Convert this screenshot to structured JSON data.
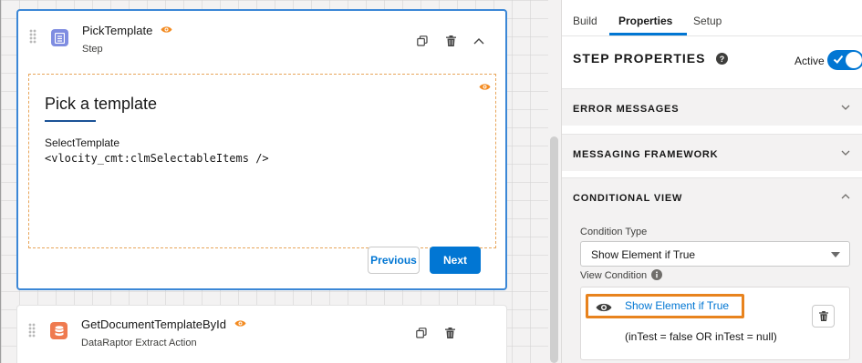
{
  "canvas": {
    "step_card": {
      "title": "PickTemplate",
      "subtitle": "Step",
      "icon": "list-doc-icon",
      "heading": "Pick a template",
      "field_label": "SelectTemplate",
      "code": "<vlocity_cmt:clmSelectableItems />",
      "prev_label": "Previous",
      "next_label": "Next",
      "actions": [
        "clone-icon",
        "delete-icon",
        "collapse-icon"
      ]
    },
    "dr_card": {
      "title": "GetDocumentTemplateById",
      "subtitle": "DataRaptor Extract Action",
      "icon": "database-icon",
      "actions": [
        "clone-icon",
        "delete-icon"
      ]
    }
  },
  "panel": {
    "tabs": [
      "Build",
      "Properties",
      "Setup"
    ],
    "active_tab": "Properties",
    "title": "STEP PROPERTIES",
    "active_label": "Active",
    "active": true,
    "sections": [
      {
        "label": "ERROR MESSAGES",
        "expanded": false
      },
      {
        "label": "MESSAGING FRAMEWORK",
        "expanded": false
      },
      {
        "label": "CONDITIONAL VIEW",
        "expanded": true
      }
    ],
    "condition_type_label": "Condition Type",
    "condition_type_value": "Show Element if True",
    "view_condition_label": "View Condition",
    "condition_link": "Show Element if True",
    "condition_expr": "(inTest = false OR inTest = null)"
  },
  "colors": {
    "accent": "#0176d3",
    "selected_border": "#3b87d6",
    "highlight": "#e8831e",
    "step_icon": "#7f8de1",
    "dataraptor_icon": "#ef7a4f"
  }
}
